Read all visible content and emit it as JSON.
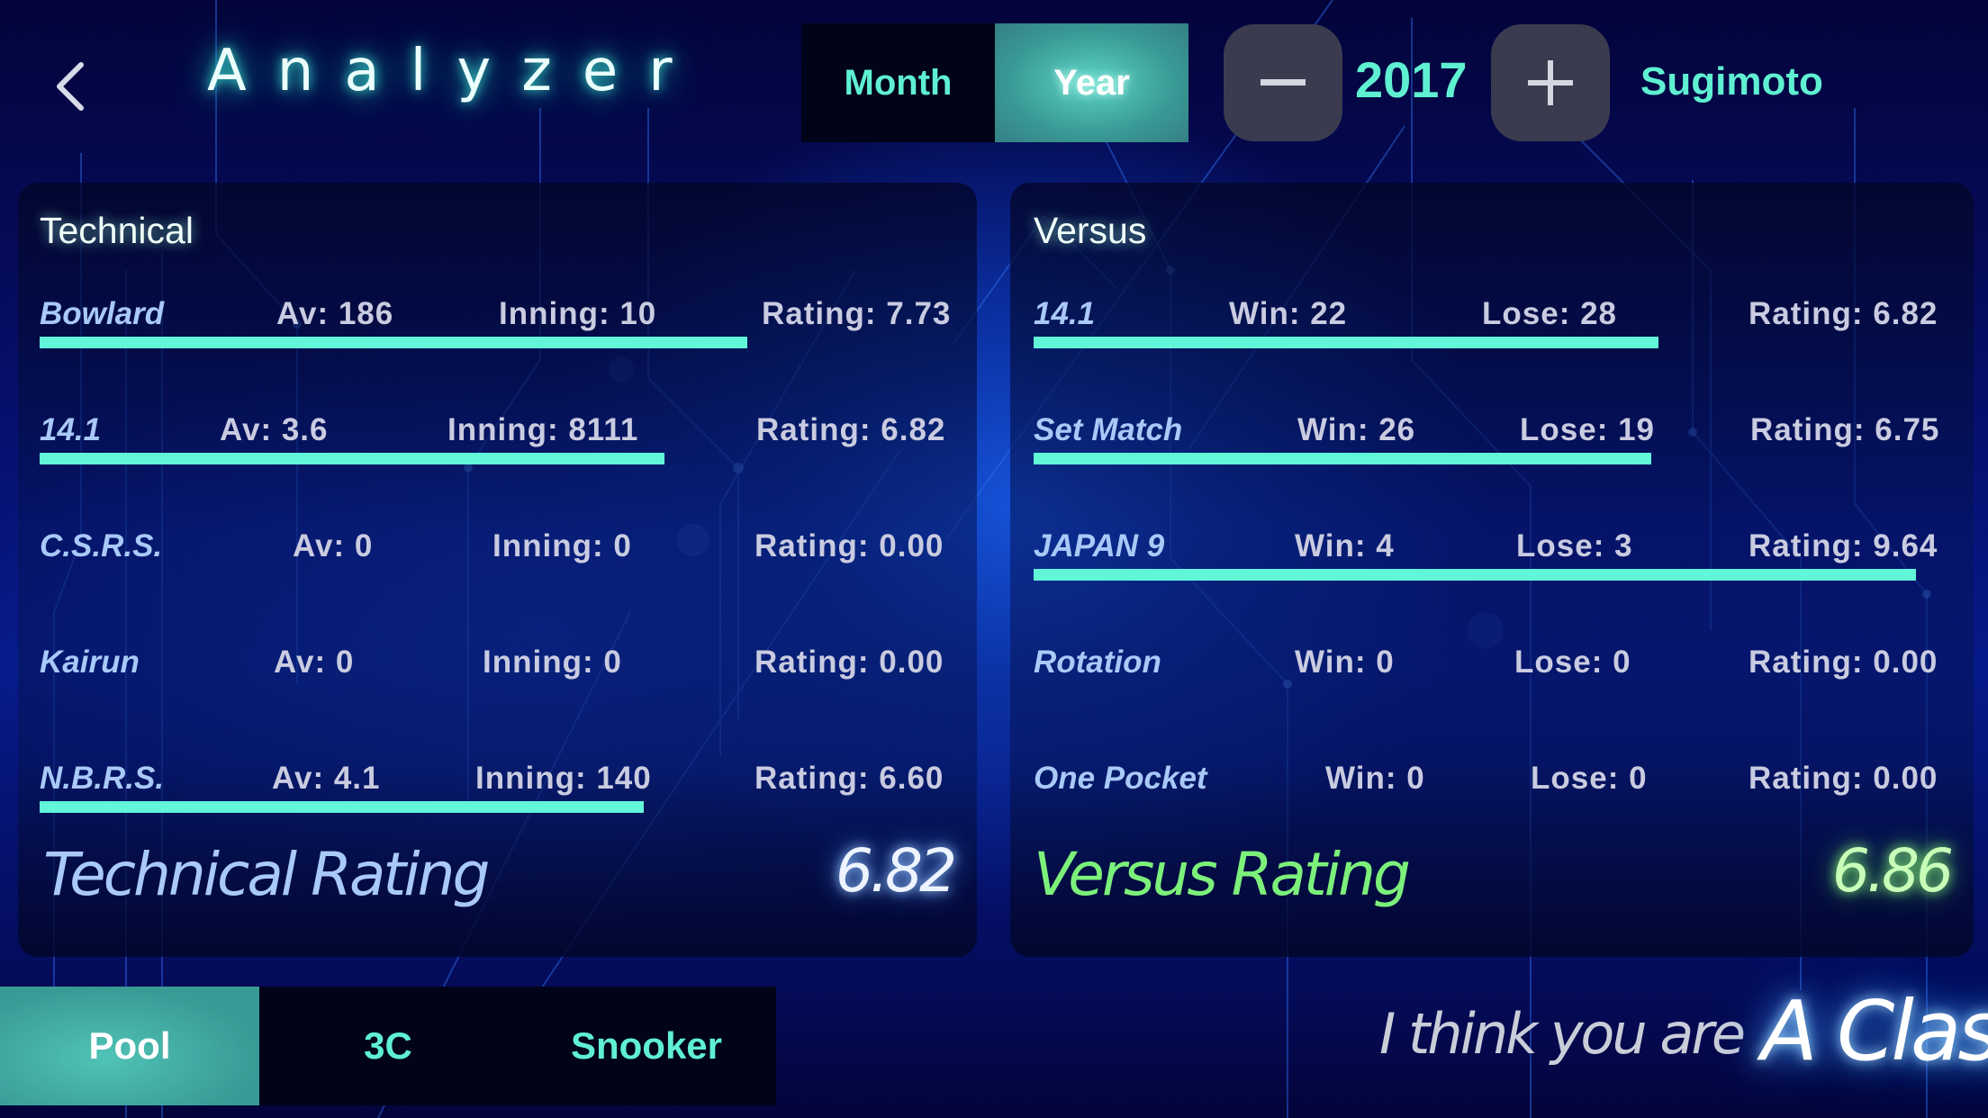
{
  "header": {
    "back_icon": "chevron-left-icon",
    "title": "Analyzer",
    "period_tabs": [
      {
        "label": "Month",
        "selected": false
      },
      {
        "label": "Year",
        "selected": true
      }
    ],
    "decrement_icon": "minus-icon",
    "year": "2017",
    "increment_icon": "plus-icon",
    "user_name": "Sugimoto"
  },
  "technical": {
    "title": "Technical",
    "rows": [
      {
        "name": "Bowlard",
        "stat1": "Av: 186",
        "stat2": "Inning: 10",
        "rating": "Rating: 7.73",
        "bar_fraction": 0.773
      },
      {
        "name": "14.1",
        "stat1": "Av: 3.6",
        "stat2": "Inning: 8111",
        "rating": "Rating: 6.82",
        "bar_fraction": 0.682
      },
      {
        "name": "C.S.R.S.",
        "stat1": "Av: 0",
        "stat2": "Inning: 0",
        "rating": "Rating: 0.00",
        "bar_fraction": 0
      },
      {
        "name": "Kairun",
        "stat1": "Av: 0",
        "stat2": "Inning: 0",
        "rating": "Rating: 0.00",
        "bar_fraction": 0
      },
      {
        "name": "N.B.R.S.",
        "stat1": "Av: 4.1",
        "stat2": "Inning: 140",
        "rating": "Rating: 6.60",
        "bar_fraction": 0.66
      }
    ],
    "summary_label": "Technical Rating",
    "summary_value": "6.82"
  },
  "versus": {
    "title": "Versus",
    "rows": [
      {
        "name": "14.1",
        "stat1": "Win: 22",
        "stat2": "Lose: 28",
        "rating": "Rating: 6.82",
        "bar_fraction": 0.682
      },
      {
        "name": "Set Match",
        "stat1": "Win: 26",
        "stat2": "Lose: 19",
        "rating": "Rating: 6.75",
        "bar_fraction": 0.675
      },
      {
        "name": "JAPAN 9",
        "stat1": "Win: 4",
        "stat2": "Lose: 3",
        "rating": "Rating: 9.64",
        "bar_fraction": 0.964
      },
      {
        "name": "Rotation",
        "stat1": "Win: 0",
        "stat2": "Lose: 0",
        "rating": "Rating: 0.00",
        "bar_fraction": 0
      },
      {
        "name": "One Pocket",
        "stat1": "Win: 0",
        "stat2": "Lose: 0",
        "rating": "Rating: 0.00",
        "bar_fraction": 0
      }
    ],
    "summary_label": "Versus Rating",
    "summary_value": "6.86"
  },
  "game_tabs": [
    {
      "label": "Pool",
      "selected": true
    },
    {
      "label": "3C",
      "selected": false
    },
    {
      "label": "Snooker",
      "selected": false
    }
  ],
  "verdict": {
    "prefix": "I think you are",
    "class_label": "A Class"
  },
  "colors": {
    "accent": "#5ff0d2",
    "bar": "#62f6d8",
    "selected_tab": "#3a9a95",
    "versus_rating": "#7cf07a",
    "technical_rating": "#a9c9f8"
  }
}
